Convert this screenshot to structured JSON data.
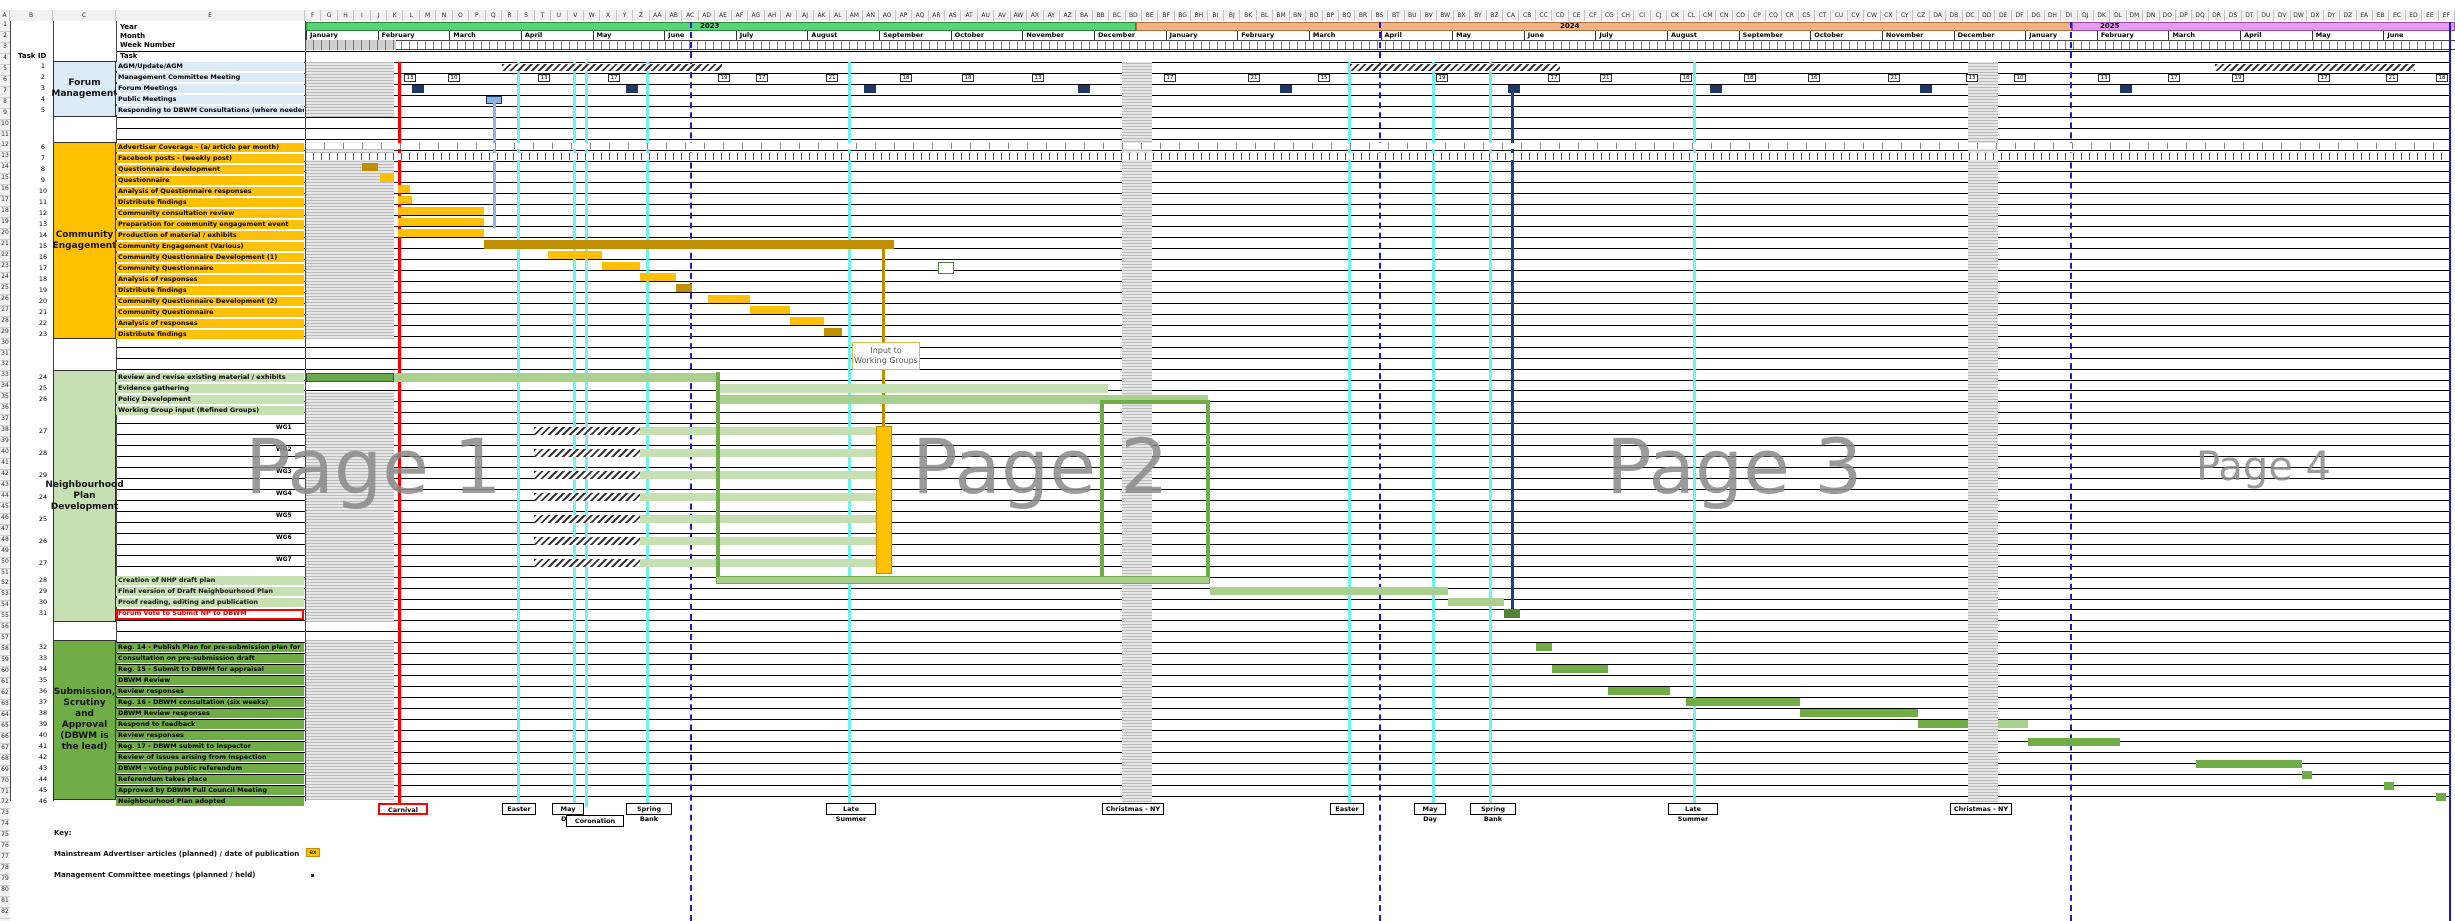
{
  "spreadsheet": {
    "row_label_year": "Year",
    "row_label_month": "Month",
    "row_label_week": "Week Number",
    "row_label_task": "Task",
    "task_id_header": "Task ID",
    "years": [
      "2023",
      "2024",
      "2025"
    ],
    "months": [
      "January",
      "February",
      "March",
      "April",
      "May",
      "June",
      "July",
      "August",
      "September",
      "October",
      "November",
      "December",
      "January",
      "February",
      "March",
      "April",
      "May",
      "June",
      "July",
      "August",
      "September",
      "October",
      "November",
      "December",
      "January",
      "February",
      "March",
      "April",
      "May",
      "June"
    ],
    "column_letters": [
      "A",
      "B",
      "C",
      "E",
      "F",
      "G",
      "H",
      "I",
      "J",
      "K",
      "L",
      "M",
      "N",
      "O",
      "P",
      "Q",
      "R",
      "S",
      "T",
      "U",
      "V",
      "W",
      "X",
      "Y",
      "Z",
      "AA",
      "AB",
      "AC",
      "AD",
      "AE",
      "AF",
      "AG",
      "AH",
      "AI",
      "AJ",
      "AK",
      "AL",
      "AM",
      "AN",
      "AO",
      "AP",
      "AQ",
      "AR",
      "AS",
      "AT",
      "AU",
      "AV",
      "AW",
      "AX",
      "AY",
      "AZ",
      "BA",
      "BB",
      "BC",
      "BD",
      "BE",
      "BF",
      "BG",
      "BH",
      "BI",
      "BJ",
      "BK",
      "BL",
      "BM",
      "BN",
      "BO",
      "BP",
      "BQ",
      "BR",
      "BS",
      "BT",
      "BU",
      "BV",
      "BW",
      "BX",
      "BY",
      "BZ",
      "CA",
      "CB",
      "CC",
      "CD",
      "CE",
      "CF",
      "CG",
      "CH",
      "CI",
      "CJ",
      "CK",
      "CL",
      "CM",
      "CN",
      "CO",
      "CP",
      "CQ",
      "CR",
      "CS",
      "CT",
      "CU",
      "CV",
      "CW",
      "CX",
      "CY",
      "CZ",
      "DA",
      "DB",
      "DC",
      "DD",
      "DE",
      "DF",
      "DG",
      "DH",
      "DI",
      "DJ",
      "DK",
      "DL",
      "DM",
      "DN",
      "DO",
      "DP",
      "DQ",
      "DR",
      "DS",
      "DT",
      "DU",
      "DV",
      "DW",
      "DX",
      "DY",
      "DZ",
      "EA",
      "EB",
      "EC",
      "ED",
      "EE",
      "EF"
    ]
  },
  "groups": {
    "forum": "Forum Management",
    "community": "Community Engagement",
    "neighbourhood": "Neighbourhood Plan Development",
    "submission": "Submission, Scrutiny and Approval (DBWM is the lead)"
  },
  "tasks_forum": [
    {
      "id": "1",
      "label": "AGM/Update/AGM"
    },
    {
      "id": "2",
      "label": "Management Committee Meeting"
    },
    {
      "id": "3",
      "label": "Forum Meetings"
    },
    {
      "id": "4",
      "label": "Public Meetings"
    },
    {
      "id": "5",
      "label": "Responding to DBWM Consultations (where needed)"
    }
  ],
  "tasks_community": [
    {
      "id": "6",
      "label": "Advertiser Coverage - (a/ article per month)"
    },
    {
      "id": "7",
      "label": "Facebook posts - (weekly post)"
    },
    {
      "id": "8",
      "label": "Questionnaire development"
    },
    {
      "id": "9",
      "label": "Questionnaire"
    },
    {
      "id": "10",
      "label": "Analysis of Questionnaire responses"
    },
    {
      "id": "11",
      "label": "Distribute findings"
    },
    {
      "id": "12",
      "label": "Community consultation review"
    },
    {
      "id": "13",
      "label": "Preparation for community engagement event"
    },
    {
      "id": "14",
      "label": "Production of material / exhibits"
    },
    {
      "id": "15",
      "label": "Community Engagement (Various)"
    },
    {
      "id": "16",
      "label": "Community Questionnaire Development (1)"
    },
    {
      "id": "17",
      "label": "Community Questionnaire"
    },
    {
      "id": "18",
      "label": "Analysis of responses"
    },
    {
      "id": "19",
      "label": "Distribute findings"
    },
    {
      "id": "20",
      "label": "Community Questionnaire Development (2)"
    },
    {
      "id": "21",
      "label": "Community Questionnaire"
    },
    {
      "id": "22",
      "label": "Analysis of responses"
    },
    {
      "id": "23",
      "label": "Distribute findings"
    }
  ],
  "tasks_plan": [
    {
      "id": "24",
      "label": "Review and revise existing material / exhibits"
    },
    {
      "id": "25",
      "label": "Evidence gathering"
    },
    {
      "id": "26",
      "label": "Policy Development"
    },
    {
      "id": "",
      "label": "Working Group input (Refined Groups)"
    },
    {
      "id": "27",
      "label": ""
    },
    {
      "id": "28",
      "label": ""
    },
    {
      "id": "29",
      "label": ""
    },
    {
      "id": "24",
      "label": ""
    },
    {
      "id": "25",
      "label": ""
    },
    {
      "id": "26",
      "label": ""
    },
    {
      "id": "27",
      "label": ""
    },
    {
      "id": "28",
      "label": "Creation of NHP draft plan"
    },
    {
      "id": "29",
      "label": "Final version of Draft Neighbourhood Plan"
    },
    {
      "id": "30",
      "label": "Proof reading, editing and publication"
    },
    {
      "id": "31",
      "label": "Forum Vote to Submit NP to DBWM"
    }
  ],
  "wg_labels": [
    "WG1",
    "WG2",
    "WG3",
    "WG4",
    "WG5",
    "WG6",
    "WG7"
  ],
  "tasks_submission": [
    {
      "id": "32",
      "label": "Reg. 14 - Publish Plan for pre-submission plan for"
    },
    {
      "id": "33",
      "label": "Consultation on pre-submission draft"
    },
    {
      "id": "34",
      "label": "Reg. 15 - Submit to DBWM for appraisal"
    },
    {
      "id": "35",
      "label": "DBWM Review"
    },
    {
      "id": "36",
      "label": "Review responses"
    },
    {
      "id": "37",
      "label": "Reg. 16 - DBWM consultation (six weeks)"
    },
    {
      "id": "38",
      "label": "DBWM Review responses"
    },
    {
      "id": "39",
      "label": "Respond to feedback"
    },
    {
      "id": "40",
      "label": "Review responses"
    },
    {
      "id": "41",
      "label": "Reg. 17 - DBWM submit to Inspector"
    },
    {
      "id": "42",
      "label": "Review of issues arising from Inspection"
    },
    {
      "id": "43",
      "label": "DBWM - voting public referendum"
    },
    {
      "id": "44",
      "label": "Referendum takes place"
    },
    {
      "id": "45",
      "label": "Approved by DBWM Full Council Meeting"
    },
    {
      "id": "46",
      "label": "Neighbourhood Plan adopted"
    }
  ],
  "pages": [
    "Page 1",
    "Page 2",
    "Page 3",
    "Page 4"
  ],
  "callout": "Input to Working Groups",
  "holidays": [
    "Carnival",
    "Easter",
    "May Day",
    "Coronation",
    "Spring Bank",
    "Late Summer",
    "Christmas - NY",
    "Easter",
    "May Day",
    "Spring Bank",
    "Late Summer",
    "Christmas - NY"
  ],
  "key": {
    "title": "Key:",
    "item1": "Mainstream Advertiser articles (planned) / date of publication",
    "item2": "Management Committee meetings (planned / held)",
    "sample1": "ex"
  },
  "dates_row6": [
    "13",
    "10",
    "13",
    "17",
    "19",
    "17",
    "21",
    "18",
    "18",
    "13",
    "17",
    "21",
    "15",
    "19",
    "17",
    "21",
    "18",
    "18",
    "16",
    "21"
  ],
  "colors": {
    "green_header": "#58d47a",
    "orange_header": "#f4b183",
    "pink_header": "#e59bf0",
    "orange_group": "#ffc000",
    "green_light": "#c6e0b4",
    "green_mid": "#a9d08e",
    "green_dark": "#70ad47",
    "blue_light": "#ddebf7",
    "red": "#ff0000"
  }
}
